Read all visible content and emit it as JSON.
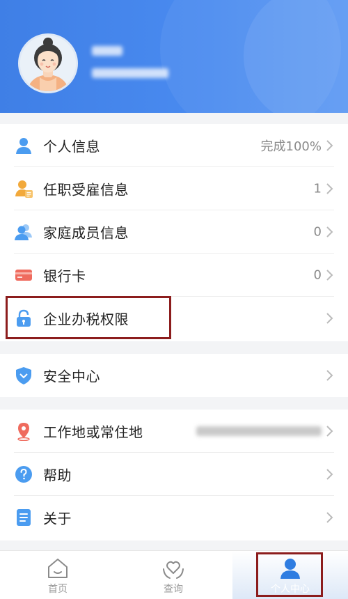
{
  "profile": {
    "avatar": "avatar-woman",
    "name_redacted": "",
    "id_redacted": ""
  },
  "menu": {
    "personal_info": {
      "label": "个人信息",
      "value": "完成100%",
      "icon": "person-icon"
    },
    "employment": {
      "label": "任职受雇信息",
      "value": "1",
      "icon": "employment-icon"
    },
    "family": {
      "label": "家庭成员信息",
      "value": "0",
      "icon": "family-icon"
    },
    "bank_card": {
      "label": "银行卡",
      "value": "0",
      "icon": "bank-card-icon"
    },
    "enterprise_tax": {
      "label": "企业办税权限",
      "icon": "lock-icon"
    },
    "security": {
      "label": "安全中心",
      "icon": "shield-icon"
    },
    "work_location": {
      "label": "工作地或常住地",
      "icon": "location-pin-icon"
    },
    "help": {
      "label": "帮助",
      "icon": "question-icon"
    },
    "about": {
      "label": "关于",
      "icon": "document-icon"
    }
  },
  "tabs": {
    "home": {
      "label": "首页",
      "icon": "home-icon"
    },
    "query": {
      "label": "查询",
      "icon": "heart-hand-icon"
    },
    "profile": {
      "label": "个人中心",
      "icon": "user-icon"
    }
  },
  "colors": {
    "header_blue": "#4a8bf0",
    "highlight_red": "#8c1d1d",
    "icon_blue": "#4b9cf0",
    "icon_orange": "#f2a93b",
    "icon_red": "#ef6b5e"
  }
}
